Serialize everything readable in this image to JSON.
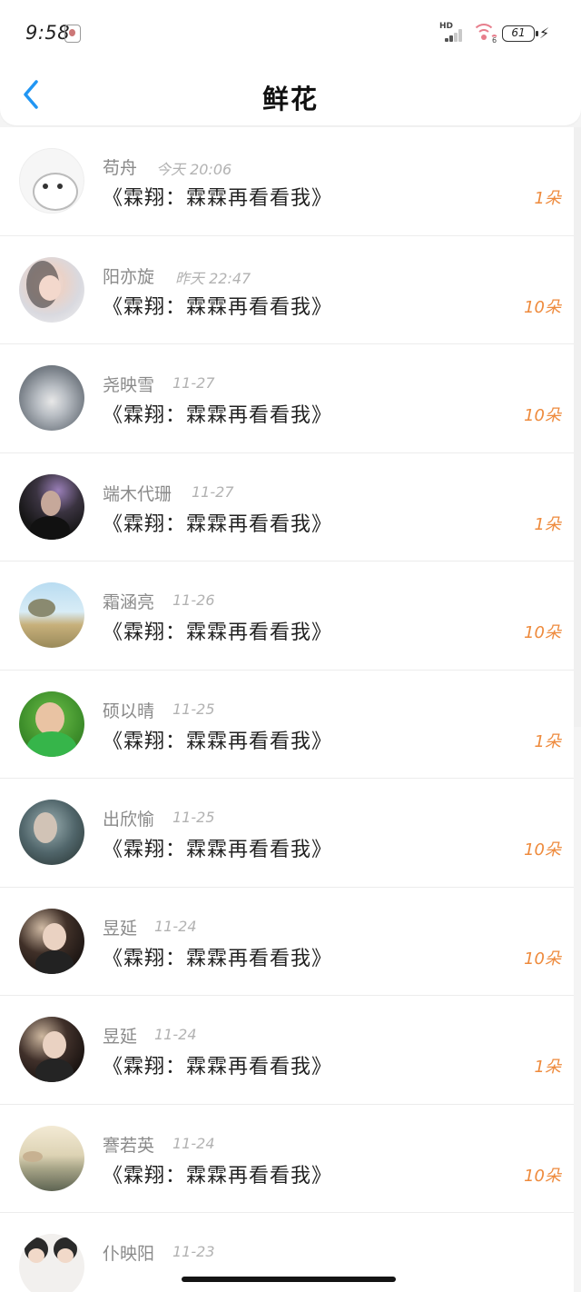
{
  "status_bar": {
    "time": "9:58",
    "network_label": "HD",
    "wifi_label": "6",
    "battery": "61"
  },
  "header": {
    "title": "鲜花"
  },
  "items": [
    {
      "name": "苟舟",
      "date": "今天 20:06",
      "message": "《霖翔：霖霖再看看我》",
      "count": "1朵"
    },
    {
      "name": "阳亦旋",
      "date": "昨天 22:47",
      "message": "《霖翔：霖霖再看看我》",
      "count": "10朵"
    },
    {
      "name": "尧映雪",
      "date": "11-27",
      "message": "《霖翔：霖霖再看看我》",
      "count": "10朵"
    },
    {
      "name": "端木代珊",
      "date": "11-27",
      "message": "《霖翔：霖霖再看看我》",
      "count": "1朵"
    },
    {
      "name": "霜涵亮",
      "date": "11-26",
      "message": "《霖翔：霖霖再看看我》",
      "count": "10朵"
    },
    {
      "name": "硕以晴",
      "date": "11-25",
      "message": "《霖翔：霖霖再看看我》",
      "count": "1朵"
    },
    {
      "name": "出欣愉",
      "date": "11-25",
      "message": "《霖翔：霖霖再看看我》",
      "count": "10朵"
    },
    {
      "name": "昱延",
      "date": "11-24",
      "message": "《霖翔：霖霖再看看我》",
      "count": "10朵"
    },
    {
      "name": "昱延",
      "date": "11-24",
      "message": "《霖翔：霖霖再看看我》",
      "count": "1朵"
    },
    {
      "name": "謇若英",
      "date": "11-24",
      "message": "《霖翔：霖霖再看看我》",
      "count": "10朵"
    },
    {
      "name": "仆映阳",
      "date": "11-23",
      "message": "",
      "count": ""
    }
  ],
  "colors": {
    "accent": "#2196f3",
    "count": "#ee8a3c"
  },
  "icons": {
    "back": "chevron-left-icon"
  }
}
